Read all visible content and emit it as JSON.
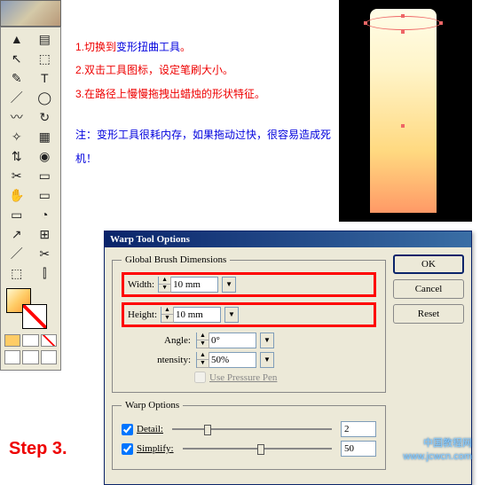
{
  "instructions": {
    "line1_prefix": "1.切换到",
    "line1_blue": "变形扭曲工具",
    "line1_suffix": "。",
    "line2": "2.双击工具图标，设定笔刷大小。",
    "line3": "3.在路径上慢慢拖拽出蜡烛的形状特征。",
    "note_label": "注：",
    "note_text": "变形工具很耗内存，如果拖动过快，很容易造成死机！"
  },
  "dialog": {
    "title": "Warp Tool Options",
    "group1": "Global Brush Dimensions",
    "width_label": "Width:",
    "width_value": "10 mm",
    "height_label": "Height:",
    "height_value": "10 mm",
    "angle_label": "Angle:",
    "angle_value": "0°",
    "intensity_label": "ntensity:",
    "intensity_value": "50%",
    "pressure_label": "Use Pressure Pen",
    "group2": "Warp Options",
    "detail_label": "Detail:",
    "detail_value": "2",
    "simplify_label": "Simplify:",
    "simplify_value": "50",
    "ok": "OK",
    "cancel": "Cancel",
    "reset": "Reset"
  },
  "step": "Step 3.",
  "watermark": {
    "l1": "中国教程网",
    "l2": "www.jcwcn.com"
  },
  "tools": [
    [
      "▲",
      "▤"
    ],
    [
      "↖",
      "⬚"
    ],
    [
      "✎",
      "T"
    ],
    [
      "／",
      "◯"
    ],
    [
      "〰",
      "↻"
    ],
    [
      "✧",
      "▦"
    ],
    [
      "⇅",
      "◉"
    ],
    [
      "✂",
      "▭"
    ],
    [
      "✋",
      "▭"
    ],
    [
      "▭",
      "◔"
    ],
    [
      "↗",
      "⊞"
    ],
    [
      "／",
      "✂"
    ],
    [
      "⬚",
      "⫿"
    ]
  ]
}
